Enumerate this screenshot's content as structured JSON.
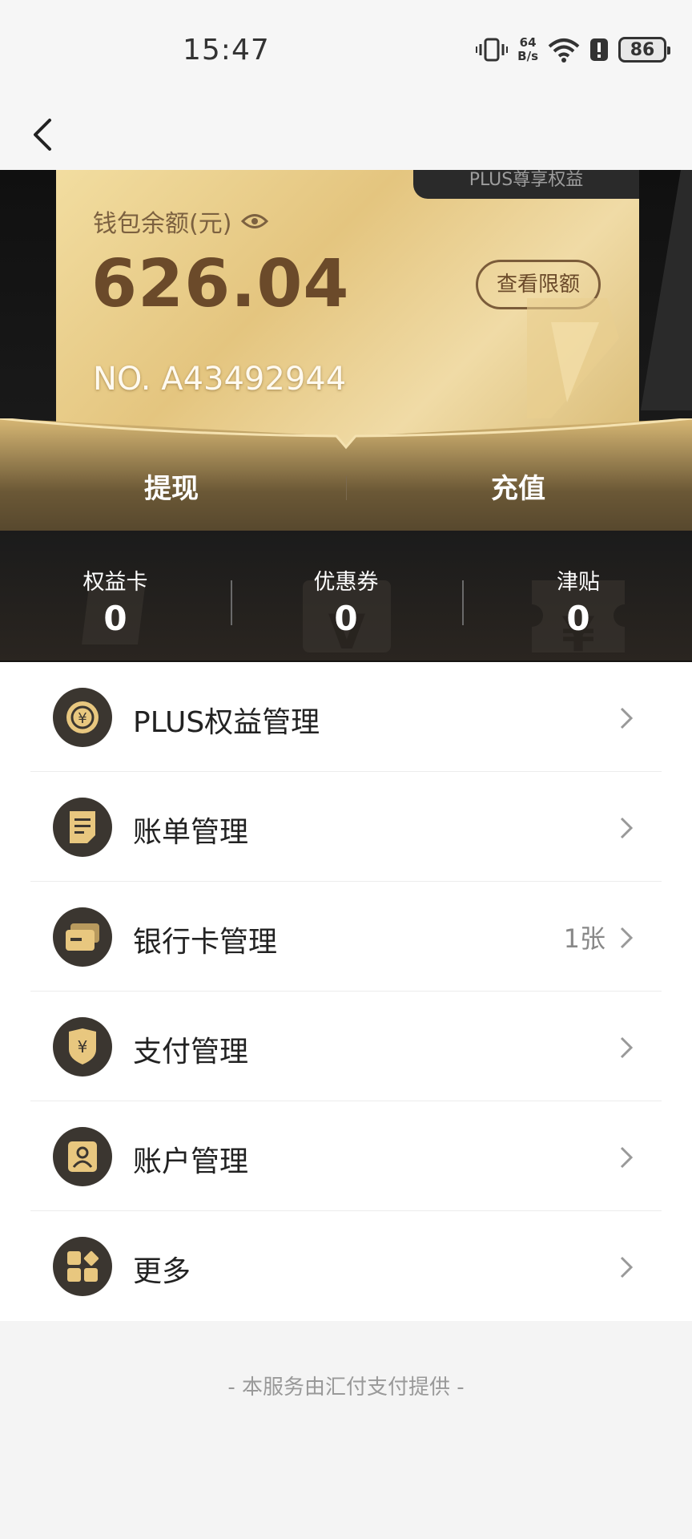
{
  "status_bar": {
    "time": "15:47",
    "net_speed_value": "64",
    "net_speed_unit": "B/s",
    "battery": "86"
  },
  "nav": {
    "back_icon": "chevron-left-icon"
  },
  "wallet": {
    "card_tab": "PLUS尊享权益",
    "balance_label": "钱包余额(元)",
    "balance": "626.04",
    "limit_button": "查看限额",
    "card_number": "NO. A43492944",
    "withdraw": "提现",
    "recharge": "充值"
  },
  "stats": [
    {
      "label": "权益卡",
      "value": "0"
    },
    {
      "label": "优惠券",
      "value": "0"
    },
    {
      "label": "津贴",
      "value": "0"
    }
  ],
  "menu": [
    {
      "label": "PLUS权益管理",
      "icon": "coin-icon",
      "extra": ""
    },
    {
      "label": "账单管理",
      "icon": "bill-icon",
      "extra": ""
    },
    {
      "label": "银行卡管理",
      "icon": "bank-card-icon",
      "extra": "1张"
    },
    {
      "label": "支付管理",
      "icon": "shield-yuan-icon",
      "extra": ""
    },
    {
      "label": "账户管理",
      "icon": "user-card-icon",
      "extra": ""
    },
    {
      "label": "更多",
      "icon": "grid-more-icon",
      "extra": ""
    }
  ],
  "footer": "- 本服务由汇付支付提供 -",
  "colors": {
    "gold": "#e4c57f",
    "dark": "#1b1b1b",
    "icon_bg": "#3b3630",
    "icon_fg": "#e8c77f"
  }
}
